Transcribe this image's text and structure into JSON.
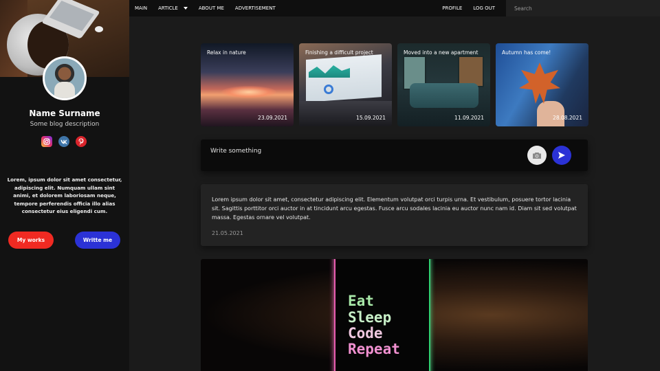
{
  "nav": {
    "items": [
      "MAIN",
      "ARTICLE",
      "ABOUT ME",
      "ADVERTISEMENT"
    ],
    "right": [
      "PROFILE",
      "LOG OUT"
    ],
    "search_placeholder": "Search"
  },
  "profile": {
    "name": "Name Surname",
    "description": "Some blog description",
    "about": "Lorem, ipsum dolor sit amet consectetur, adipiscing elit. Numquam ullam sint animi, et dolorem laboriosam neque, tempore perferendis officia illo alias consectetur eius eligendi cum.",
    "socials": [
      "instagram-icon",
      "vk-icon",
      "pinterest-icon"
    ],
    "buttons": {
      "works": "My works",
      "write": "Writte me"
    }
  },
  "cards": [
    {
      "title": "Relax in nature",
      "date": "23.09.2021"
    },
    {
      "title": "Finishing a difficult project",
      "date": "15.09.2021"
    },
    {
      "title": "Moved into a new apartment",
      "date": "11.09.2021"
    },
    {
      "title": "Autumn has come!",
      "date": "28.08.2021"
    }
  ],
  "composer": {
    "placeholder": "Write something"
  },
  "post": {
    "text": "Lorem ipsum dolor sit amet, consectetur adipiscing elit. Elementum volutpat orci turpis urna. Et vestibulum, posuere tortor lacinia sit. Sagittis porttitor orci auctor in at tincidunt arcu egestas. Fusce arcu sodales lacinia eu auctor nunc nam id. Diam sit sed volutpat massa. Egestas ornare vel volutpat.",
    "date": "21.05.2021"
  },
  "image_post": {
    "lines": [
      "Eat",
      "Sleep",
      "Code",
      "Repeat"
    ]
  },
  "colors": {
    "accent_red": "#f02a22",
    "accent_blue": "#2b32d6",
    "background": "#1b1b1b",
    "sidebar": "#121212"
  }
}
